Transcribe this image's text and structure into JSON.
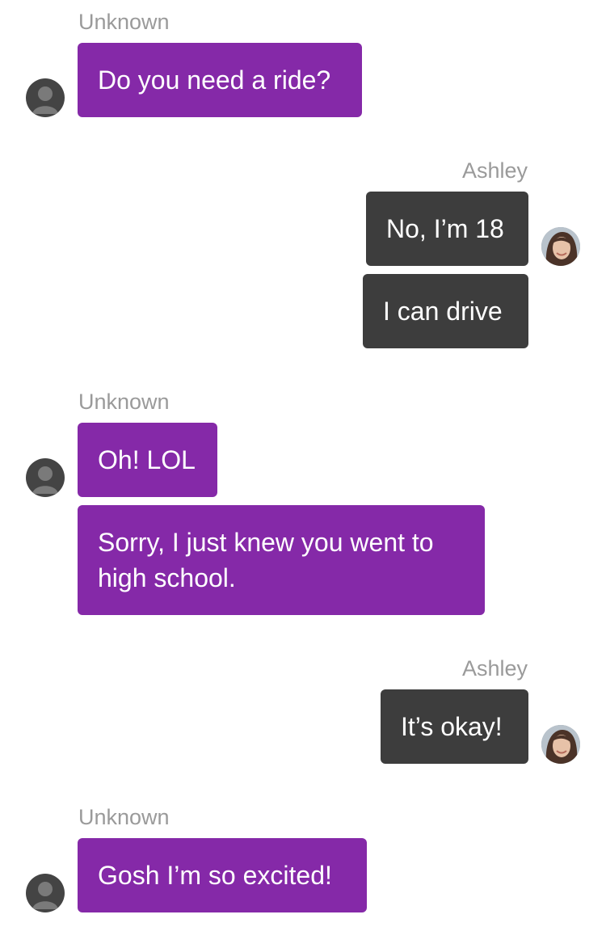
{
  "messages": [
    {
      "sender": "Unknown",
      "side": "in",
      "bubbles": [
        "Do you need a ride?"
      ],
      "avatar": "default-user-icon"
    },
    {
      "sender": "Ashley",
      "side": "out",
      "bubbles": [
        "No, I’m 18",
        "I can drive"
      ],
      "avatar": "ashley-photo"
    },
    {
      "sender": "Unknown",
      "side": "in",
      "bubbles": [
        "Oh! LOL",
        "Sorry, I just knew you went to high school."
      ],
      "avatar": "default-user-icon"
    },
    {
      "sender": "Ashley",
      "side": "out",
      "bubbles": [
        "It’s okay!"
      ],
      "avatar": "ashley-photo"
    },
    {
      "sender": "Unknown",
      "side": "in",
      "bubbles": [
        "Gosh I’m so excited!"
      ],
      "avatar": "default-user-icon"
    }
  ],
  "colors": {
    "incoming_bubble": "#8529a8",
    "outgoing_bubble": "#3d3d3d",
    "sender_label": "#9a9a9a",
    "avatar_default": "#444444"
  }
}
